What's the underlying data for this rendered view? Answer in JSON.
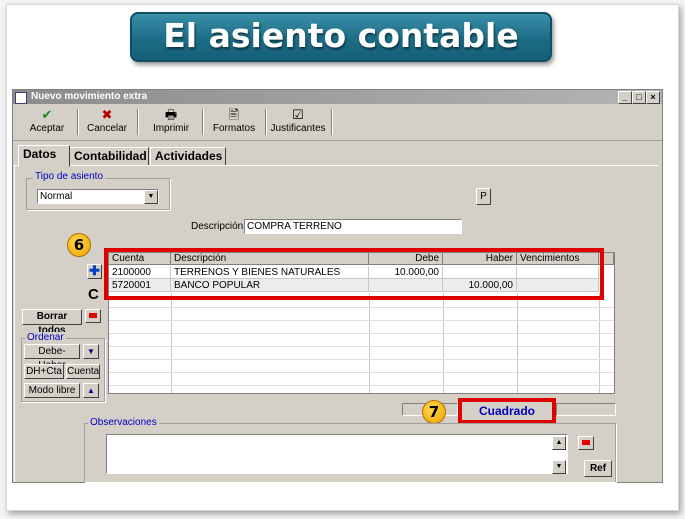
{
  "banner": {
    "title": "El asiento contable"
  },
  "window": {
    "title": "Nuevo movimiento extra",
    "controls": [
      "_",
      "□",
      "×"
    ]
  },
  "toolbar": [
    {
      "label": "Aceptar",
      "icon": "checkmark-icon",
      "glyph": "✔",
      "color": "#1a8a1a"
    },
    {
      "label": "Cancelar",
      "icon": "cancel-x-icon",
      "glyph": "✖",
      "color": "#b00000"
    },
    {
      "label": "Imprimir",
      "icon": "printer-icon",
      "glyph": "🖶",
      "color": "#333333"
    },
    {
      "label": "Formatos",
      "icon": "formats-icon",
      "glyph": "🖹",
      "color": "#333333"
    },
    {
      "label": "Justificantes",
      "icon": "receipts-icon",
      "glyph": "☑",
      "color": "#333333"
    }
  ],
  "tabs": [
    "Datos",
    "Contabilidad",
    "Actividades"
  ],
  "tipo_asiento": {
    "legend": "Tipo de asiento",
    "selected": "Normal"
  },
  "p_button": "P",
  "descripcion": {
    "label": "Descripción :",
    "value": "COMPRA TERRENO"
  },
  "grid": {
    "columns": [
      "Cuenta",
      "Descripción",
      "Debe",
      "Haber",
      "Vencimientos"
    ],
    "rows": [
      {
        "cuenta": "2100000",
        "descripcion": "TERRENOS Y BIENES NATURALES",
        "debe": "10.000,00",
        "haber": "",
        "vencimientos": ""
      },
      {
        "cuenta": "5720001",
        "descripcion": "BANCO POPULAR",
        "debe": "",
        "haber": "10.000,00",
        "vencimientos": ""
      }
    ]
  },
  "side": {
    "borrar_todos": "Borrar todos",
    "ordenar_legend": "Ordenar",
    "debe_haber": "Debe-Haber",
    "dh_cta": "DH+Cta",
    "cuenta": "Cuenta",
    "modo_libre": "Modo libre",
    "c_label": "C"
  },
  "status": {
    "value": "Cuadrado",
    "color": "#0000c0"
  },
  "observaciones": {
    "legend": "Observaciones",
    "ref": "Ref"
  },
  "badges": {
    "grid": "6",
    "status": "7"
  },
  "colors": {
    "highlight": "#e00000",
    "badge": "#f5b800",
    "banner": "#1c6c86"
  }
}
